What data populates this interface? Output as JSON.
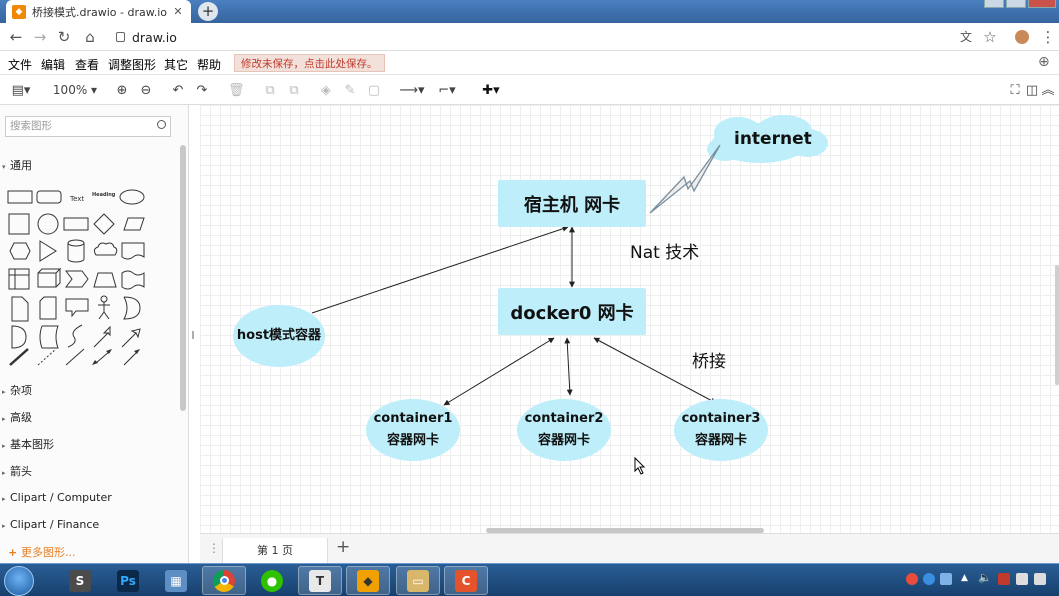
{
  "browser": {
    "tab_title": "桥接模式.drawio - draw.io",
    "tab_icon": "drawio-icon",
    "url": "draw.io"
  },
  "menubar": {
    "items": [
      "文件",
      "编辑",
      "查看",
      "调整图形",
      "其它",
      "帮助"
    ],
    "unsaved_notice": "修改未保存，点击此处保存。"
  },
  "toolbar": {
    "zoom": "100%"
  },
  "sidebar": {
    "search_placeholder": "搜索图形",
    "general_section": "通用",
    "shape_text_sample": "Text",
    "shape_heading_sample": "Heading",
    "sections": [
      "杂项",
      "高级",
      "基本图形",
      "箭头",
      "Clipart / Computer",
      "Clipart / Finance"
    ],
    "more_shapes": "更多图形..."
  },
  "diagram": {
    "host_nic": "宿主机 网卡",
    "docker0": "docker0 网卡",
    "internet": "internet",
    "host_container": "host模式容器",
    "nat_label": "Nat 技术",
    "bridge_label": "桥接",
    "containers": [
      {
        "name": "container1",
        "sub": "容器网卡"
      },
      {
        "name": "container2",
        "sub": "容器网卡"
      },
      {
        "name": "container3",
        "sub": "容器网卡"
      }
    ],
    "node_fill": "#bdeefa"
  },
  "pages": {
    "current": "第 1 页"
  },
  "taskbar": {
    "apps": [
      "sublime-icon",
      "photoshop-icon",
      "network-icon",
      "chrome-icon",
      "wechat-icon",
      "typora-icon",
      "drawio-icon",
      "explorer-icon",
      "camtasia-icon"
    ]
  }
}
